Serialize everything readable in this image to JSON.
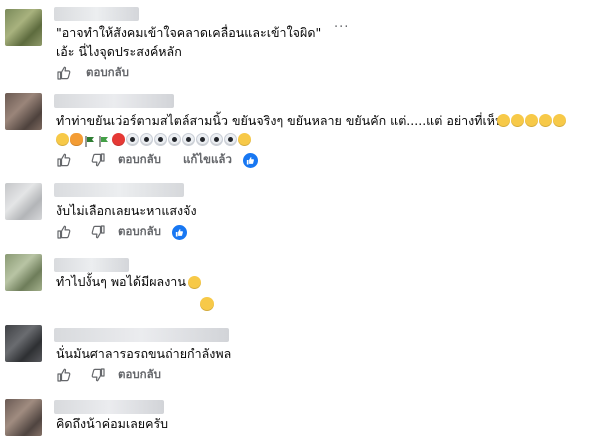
{
  "comments": [
    {
      "lines": [
        "\"อาจทำให้สังคมเข้าใจคลาดเคลื่อนและเข้าใจผิด\"",
        "เอ้ะ นี่ไงจุดประสงค์หลัก"
      ],
      "more": "···",
      "actions": {
        "reply": "ตอบกลับ"
      }
    },
    {
      "lines": [
        "ทำท่าขยันเว่อร์ตามสไตล์สามนิ้ว ขยันจริงๆ ขยันหลาย ขยันคัก แต่.....แต่ อย่างที่เห็น"
      ],
      "actions": {
        "reply": "ตอบกลับ",
        "edited": "แก้ไขแล้ว"
      }
    },
    {
      "lines": [
        "งับไม่เลือกเลยนะหาแสงจัง"
      ],
      "actions": {
        "reply": "ตอบกลับ"
      }
    },
    {
      "lines": [
        "ทำไปงั้นๆ พอได้มีผลงาน"
      ],
      "actions": {}
    },
    {
      "lines": [
        "นั่นมันศาลารอรถขนถ่ายกำลังพล"
      ],
      "actions": {
        "reply": "ตอบกลับ"
      }
    },
    {
      "lines": [
        "คิดถึงน้าค่อมเลยครับ"
      ],
      "actions": {}
    }
  ],
  "icons": {
    "like": "thumbs-up-icon",
    "dislike": "thumbs-down-icon",
    "reaction_like": "like-reaction-icon",
    "reaction_haha": "haha-reaction-icon"
  },
  "colors": {
    "muted": "#65676b",
    "facebook_blue": "#1877f2"
  }
}
